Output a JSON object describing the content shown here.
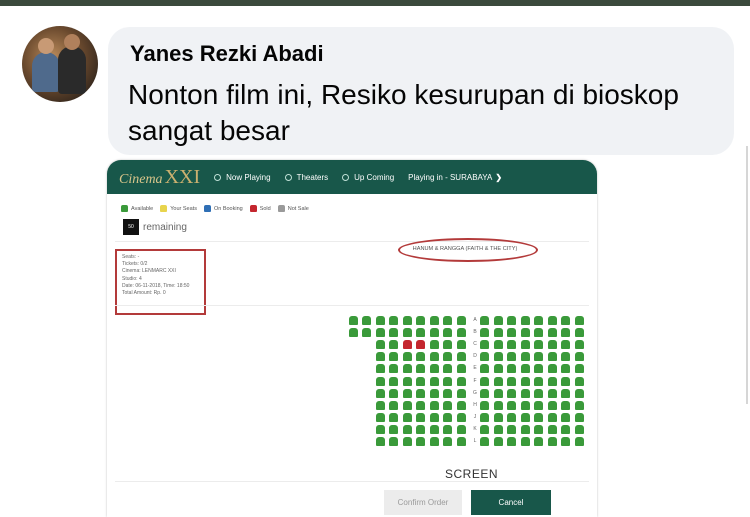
{
  "post": {
    "author": "Yanes Rezki Abadi",
    "message": "Nonton film ini, Resiko kesurupan di bioskop sangat besar"
  },
  "cinema": {
    "brand_prefix": "Cinema",
    "brand_suffix": "XXI",
    "nav": [
      "Now Playing",
      "Theaters",
      "Up Coming",
      "Playing in - SURABAYA"
    ],
    "legend": [
      "Available",
      "Your Seats",
      "On Booking",
      "Sold",
      "Not Sale"
    ],
    "remaining_count": "50",
    "remaining_label": "remaining",
    "info_lines": [
      "Seats: -",
      "Tickets: 0/2",
      "Cinema: LENMARC XXI",
      "Studio: 4",
      "Date: 06-11-2018, Time: 18:50",
      "Total Amount: Rp. 0"
    ],
    "movie_title": "HANUM & RANGGA (FAITH & THE CITY)",
    "row_labels": [
      "A",
      "B",
      "C",
      "D",
      "E",
      "F",
      "G",
      "H",
      "J",
      "K",
      "L"
    ],
    "screen_label": "SCREEN",
    "confirm_label": "Confirm Order",
    "cancel_label": "Cancel",
    "colors": {
      "nav_bg": "#18574a",
      "available": "#3a9a3a",
      "your_seats": "#e8d44d",
      "on_booking": "#2f6fb5",
      "sold": "#c4262e",
      "not_sale": "#9a9a9a",
      "highlight": "#b33a3a"
    },
    "seat_map": {
      "total_rows": 11,
      "left_block_seats_rows_ab": 9,
      "left_block_seats_other_rows": 7,
      "right_block_seats": 8,
      "sold_seats": [
        {
          "row": "C",
          "block": "left",
          "position": 2
        },
        {
          "row": "C",
          "block": "left",
          "position": 3
        }
      ]
    }
  }
}
